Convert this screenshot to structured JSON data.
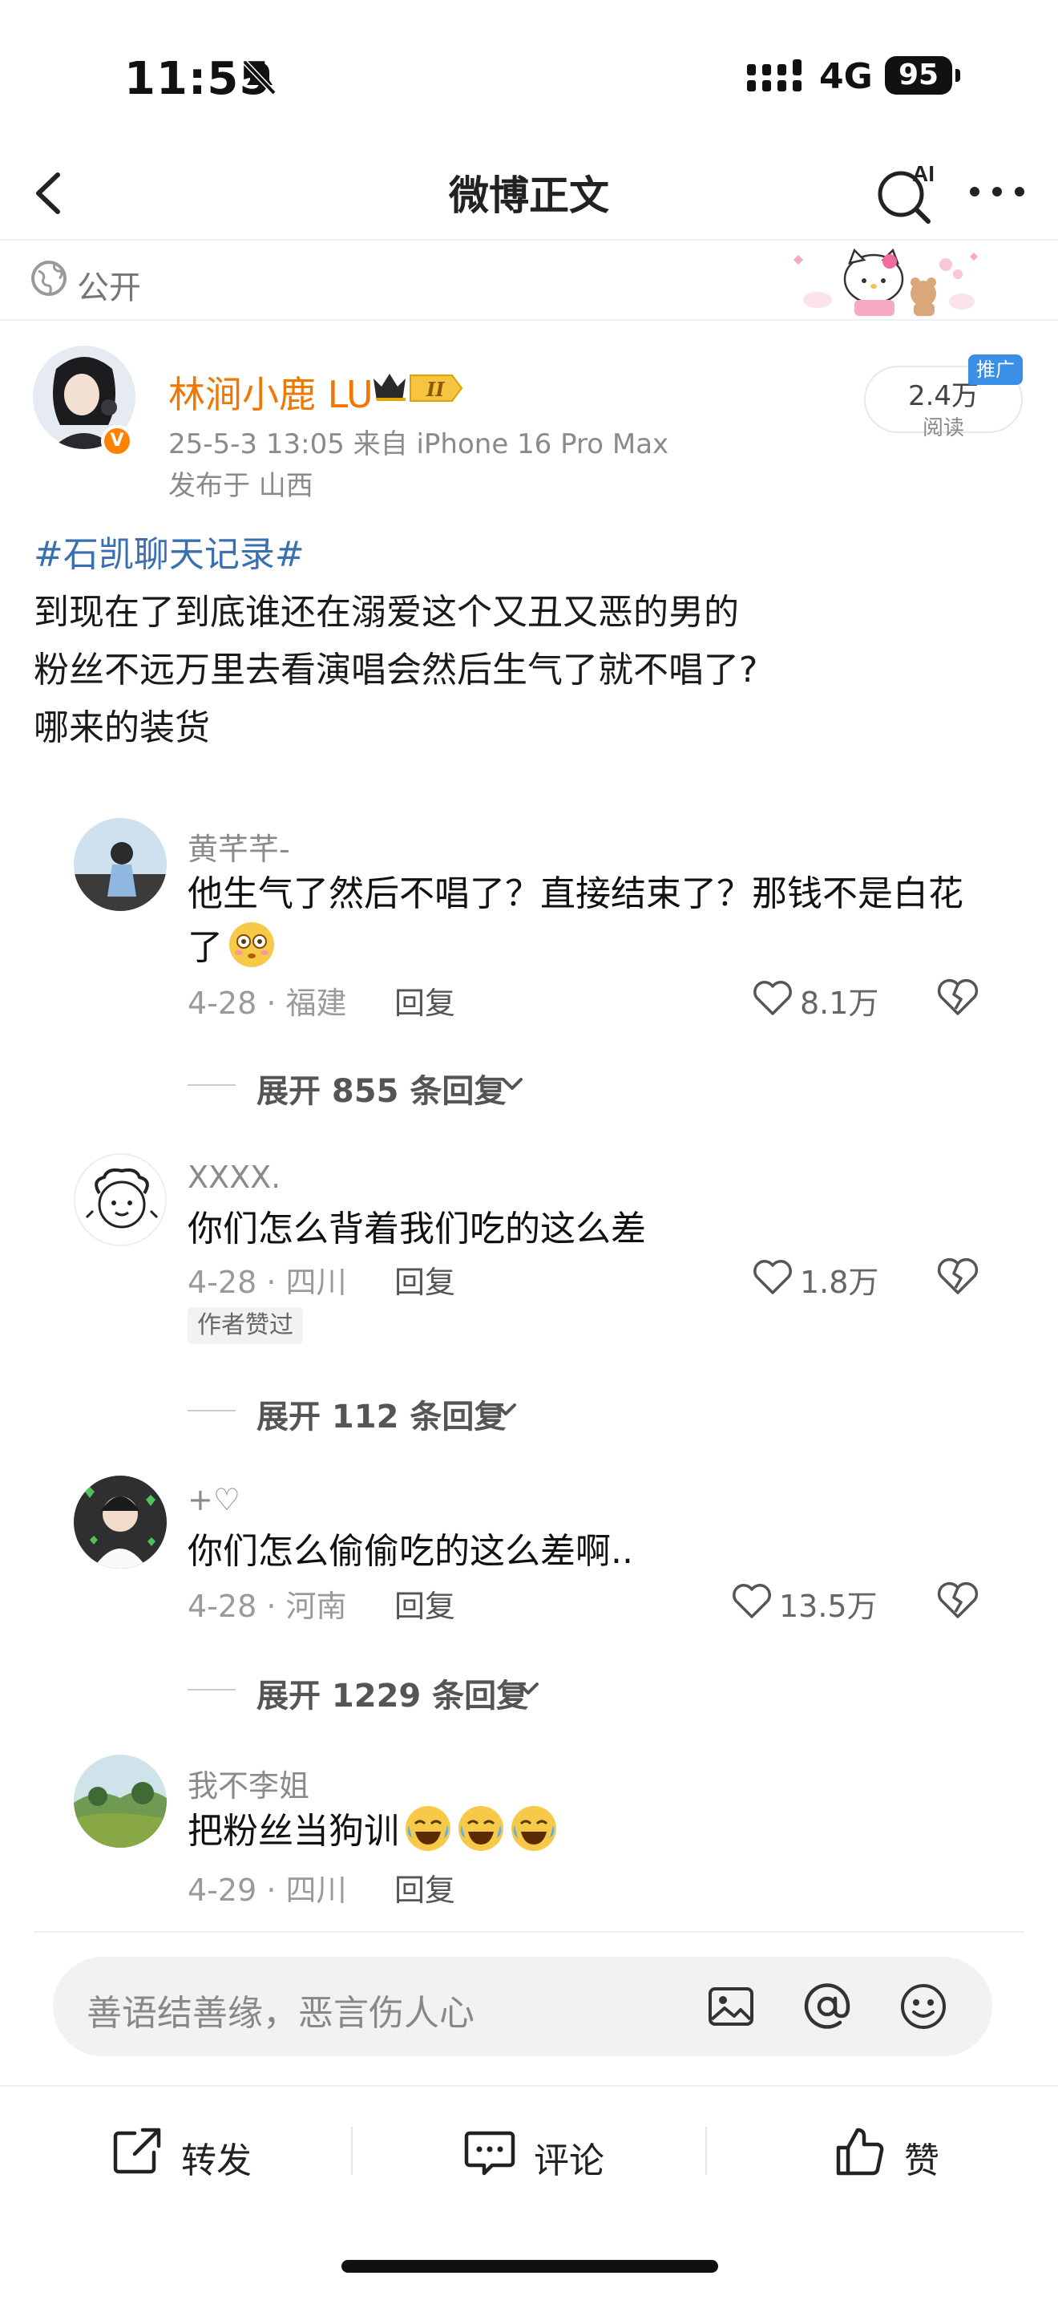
{
  "status_bar": {
    "time": "11:55",
    "network": "4G",
    "battery": "95"
  },
  "nav": {
    "title": "微博正文",
    "ai_label": "AI"
  },
  "visibility": {
    "label": "公开"
  },
  "post": {
    "author": "林涧小鹿 LU",
    "level_badge": "II",
    "meta": "25-5-3 13:05  来自 iPhone 16 Pro Max",
    "location": "发布于 山西",
    "reads_count": "2.4万",
    "reads_label": "阅读",
    "promo_tag": "推广",
    "hashtag": "#石凯聊天记录#",
    "lines": [
      "到现在了到底谁还在溺爱这个又丑又恶的男的",
      "粉丝不远万里去看演唱会然后生气了就不唱了?",
      "哪来的装货"
    ]
  },
  "comments": [
    {
      "name": "黄芊芊-",
      "text": "他生气了然后不唱了？直接结束了？那钱不是白花了",
      "meta": "4-28 · 福建",
      "reply": "回复",
      "likes": "8.1万",
      "expand": "展开 855 条回复"
    },
    {
      "name": "XXXX.",
      "text": "你们怎么背着我们吃的这么差",
      "meta": "4-28 · 四川",
      "reply": "回复",
      "likes": "1.8万",
      "author_liked": "作者赞过",
      "expand": "展开 112 条回复"
    },
    {
      "name": "+♡",
      "text": "你们怎么偷偷吃的这么差啊..",
      "meta": "4-28 · 河南",
      "reply": "回复",
      "likes": "13.5万",
      "expand": "展开 1229 条回复"
    },
    {
      "name": "我不李姐",
      "text": "把粉丝当狗训",
      "meta": "4-29 · 四川",
      "reply": "回复"
    }
  ],
  "input": {
    "placeholder": "善语结善缘，恶言伤人心"
  },
  "actions": {
    "repost": "转发",
    "comment": "评论",
    "like": "赞"
  },
  "colors": {
    "author_name": "#f07800",
    "hashtag": "#3a6fb0",
    "verified": "#ff8200",
    "promo": "#3a8ee6"
  }
}
